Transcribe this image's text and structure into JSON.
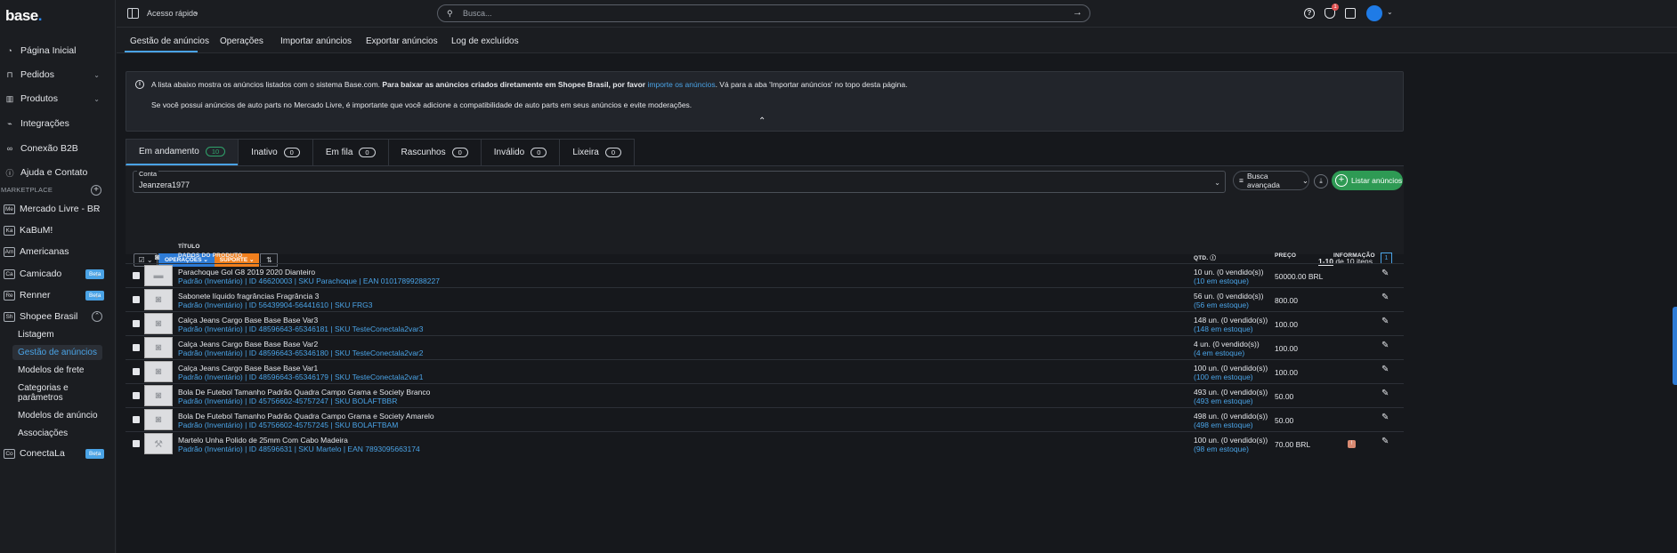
{
  "brand": {
    "name": "base",
    "dot": "."
  },
  "sidebar": {
    "items": [
      {
        "label": "Página Inicial",
        "icon": "gauge-icon",
        "chev": ""
      },
      {
        "label": "Pedidos",
        "icon": "cart-icon",
        "chev": "⌄"
      },
      {
        "label": "Produtos",
        "icon": "chart-icon",
        "chev": "⌄"
      },
      {
        "label": "Integrações",
        "icon": "plug-icon",
        "chev": ""
      },
      {
        "label": "Conexão B2B",
        "icon": "link-icon",
        "chev": ""
      },
      {
        "label": "Ajuda e Contato",
        "icon": "help-icon",
        "chev": ""
      }
    ],
    "marketplace_header": "MARKETPLACE",
    "marketplaces": [
      {
        "badge": "Me",
        "label": "Mercado Livre - BR",
        "beta": "",
        "chev": "⌄"
      },
      {
        "badge": "Ka",
        "label": "KaBuM!",
        "beta": "",
        "chev": ""
      },
      {
        "badge": "Am",
        "label": "Americanas",
        "beta": "",
        "chev": ""
      },
      {
        "badge": "Ca",
        "label": "Camicado",
        "beta": "Beta",
        "chev": "⌄"
      },
      {
        "badge": "Re",
        "label": "Renner",
        "beta": "Beta",
        "chev": "⌄"
      },
      {
        "badge": "Sh",
        "label": "Shopee Brasil",
        "beta": "",
        "chev": "⌃"
      }
    ],
    "shopee_sub": [
      "Listagem",
      "Gestão de anúncios",
      "Modelos de frete",
      "Categorias e",
      "parâmetros",
      "Modelos de anúncio",
      "Associações"
    ],
    "conectala": {
      "badge": "Co",
      "label": "ConectaLa",
      "beta": "Beta",
      "chev": "⌄"
    }
  },
  "topbar": {
    "quick_access": "Acesso rápido",
    "search_placeholder": "Busca...",
    "notif_count": "1"
  },
  "subnav": [
    "Gestão de anúncios",
    "Operações",
    "Importar anúncios",
    "Exportar anúncios",
    "Log de excluídos"
  ],
  "info": {
    "line1_a": "A lista abaixo mostra os anúncios listados com o sistema Base.com.",
    "line1_b": "Para baixar as anúncios criados diretamente em Shopee Brasil, por favor",
    "line1_link": "importe os anúncios",
    "line1_c": ". Vá para a aba 'Importar anúncios' no topo desta página.",
    "line2": "Se você possui anúncios de auto parts no Mercado Livre, é importante que você adicione a compatibilidade de auto parts em seus anúncios e evite moderações."
  },
  "tabs": [
    {
      "label": "Em andamento",
      "count": "10"
    },
    {
      "label": "Inativo",
      "count": "0"
    },
    {
      "label": "Em fila",
      "count": "0"
    },
    {
      "label": "Rascunhos",
      "count": "0"
    },
    {
      "label": "Inválido",
      "count": "0"
    },
    {
      "label": "Lixeira",
      "count": "0"
    }
  ],
  "filter": {
    "conta_label": "Conta",
    "conta_value": "Jeanzera1977",
    "busca": "Busca avançada",
    "listar": "Listar anúncios"
  },
  "toolbar": {
    "operacoes": "OPERAÇÕES ⌄",
    "suporte": "SUPORTE ⌄"
  },
  "pagination": {
    "range": "1-10",
    "rest": " de 10 itens",
    "page": "1"
  },
  "table": {
    "headers": {
      "titulo": "TÍTULO",
      "dados": "DADOS DO PRODUTO",
      "qtd": "QTD.",
      "preco": "PREÇO",
      "info": "INFORMAÇÃO"
    },
    "rows": [
      {
        "title": "Parachoque Gol G8 2019 2020 Dianteiro",
        "meta": "Padrão (Inventário) | ID 46620003 | SKU Parachoque | EAN 01017899288227",
        "qty": "10 un. (0 vendido(s))",
        "stock": "(10 em estoque)",
        "price": "50000.00 BRL",
        "thumb": "car"
      },
      {
        "title": "Sabonete líquido fragrâncias Fragrância 3",
        "meta": "Padrão (Inventário) | ID 56439904-56441610 | SKU FRG3",
        "qty": "56 un. (0 vendido(s))",
        "stock": "(56 em estoque)",
        "price": "800.00",
        "thumb": "cam"
      },
      {
        "title": "Calça Jeans Cargo Base Base Base Var3",
        "meta": "Padrão (Inventário) | ID 48596643-65346181 | SKU TesteConectala2var3",
        "qty": "148 un. (0 vendido(s))",
        "stock": "(148 em estoque)",
        "price": "100.00",
        "thumb": "cam"
      },
      {
        "title": "Calça Jeans Cargo Base Base Base Var2",
        "meta": "Padrão (Inventário) | ID 48596643-65346180 | SKU TesteConectala2var2",
        "qty": "4 un. (0 vendido(s))",
        "stock": "(4 em estoque)",
        "price": "100.00",
        "thumb": "cam"
      },
      {
        "title": "Calça Jeans Cargo Base Base Base Var1",
        "meta": "Padrão (Inventário) | ID 48596643-65346179 | SKU TesteConectala2var1",
        "qty": "100 un. (0 vendido(s))",
        "stock": "(100 em estoque)",
        "price": "100.00",
        "thumb": "cam"
      },
      {
        "title": "Bola De Futebol Tamanho Padrão Quadra Campo Grama e Society Branco",
        "meta": "Padrão (Inventário) | ID 45756602-45757247 | SKU BOLAFTBBR",
        "qty": "493 un. (0 vendido(s))",
        "stock": "(493 em estoque)",
        "price": "50.00",
        "thumb": "cam"
      },
      {
        "title": "Bola De Futebol Tamanho Padrão Quadra Campo Grama e Society Amarelo",
        "meta": "Padrão (Inventário) | ID 45756602-45757245 | SKU BOLAFTBAM",
        "qty": "498 un. (0 vendido(s))",
        "stock": "(498 em estoque)",
        "price": "50.00",
        "thumb": "cam"
      },
      {
        "title": "Martelo Unha Polido de 25mm Com Cabo Madeira",
        "meta": "Padrão (Inventário) | ID 48596631 | SKU Martelo | EAN 7893095663174",
        "qty": "100 un. (0 vendido(s))",
        "stock": "(98 em estoque)",
        "price": "70.00 BRL",
        "thumb": "hammer"
      }
    ]
  }
}
